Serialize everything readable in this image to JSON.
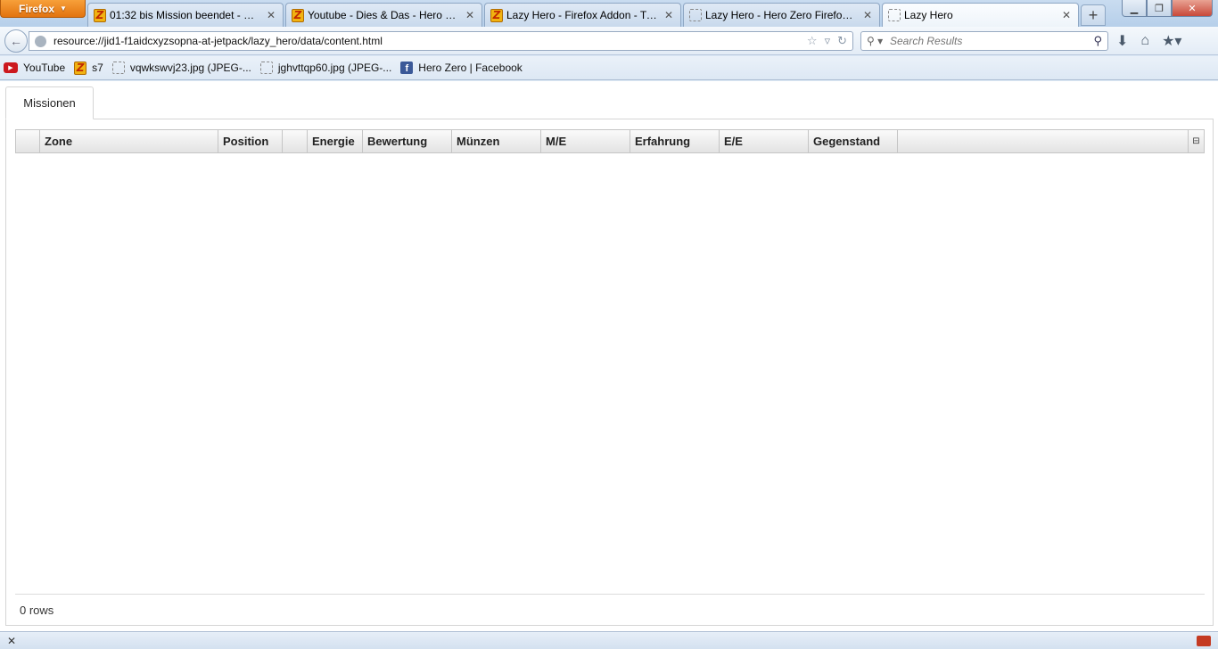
{
  "browser": {
    "menu_label": "Firefox",
    "tabs": [
      {
        "label": "01:32 bis Mission beendet - Her...",
        "icon": "hero-zero-icon"
      },
      {
        "label": "Youtube - Dies & Das - Hero Zer...",
        "icon": "hero-zero-icon"
      },
      {
        "label": "Lazy Hero - Firefox Addon - Tip...",
        "icon": "hero-zero-icon"
      },
      {
        "label": "Lazy Hero - Hero Zero Firefox A...",
        "icon": "blank-page-icon"
      },
      {
        "label": "Lazy Hero",
        "icon": "blank-page-icon",
        "active": true
      }
    ],
    "url": "resource://jid1-f1aidcxyzsopna-at-jetpack/lazy_hero/data/content.html",
    "search_placeholder": "Search Results",
    "bookmarks": [
      {
        "label": "YouTube",
        "icon": "youtube-icon"
      },
      {
        "label": "s7",
        "icon": "hero-zero-icon"
      },
      {
        "label": "vqwkswvj23.jpg (JPEG-...",
        "icon": "blank-page-icon"
      },
      {
        "label": "jghvttqp60.jpg (JPEG-...",
        "icon": "blank-page-icon"
      },
      {
        "label": "Hero Zero | Facebook",
        "icon": "facebook-icon"
      }
    ]
  },
  "page": {
    "tab_label": "Missionen",
    "columns": [
      "",
      "Zone",
      "Position",
      "",
      "Energie",
      "Bewertung",
      "Münzen",
      "M/E",
      "Erfahrung",
      "E/E",
      "Gegenstand",
      ""
    ],
    "footer": "0 rows"
  }
}
